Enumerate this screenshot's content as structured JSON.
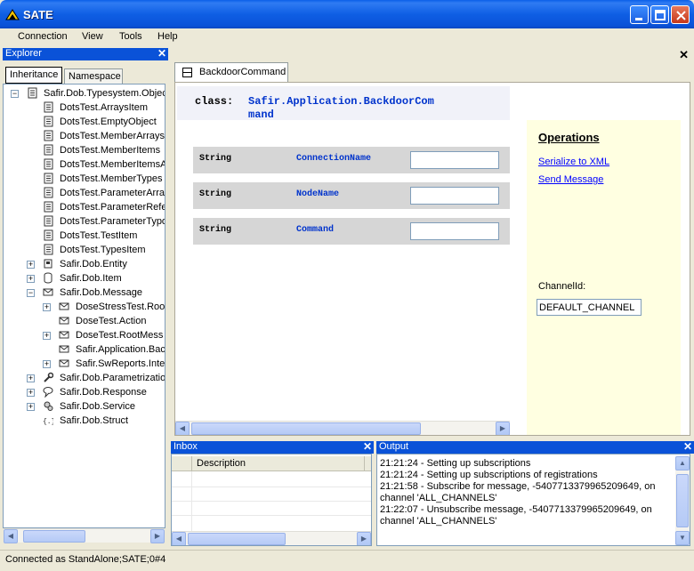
{
  "window": {
    "title": "SATE"
  },
  "menu": [
    "Connection",
    "View",
    "Tools",
    "Help"
  ],
  "explorer": {
    "title": "Explorer",
    "tabs": [
      "Inheritance",
      "Namespace"
    ],
    "tree": [
      {
        "label": "Safir.Dob.Typesystem.Objec",
        "level": 0,
        "expander": "-",
        "icon": "document-icon"
      },
      {
        "label": "DotsTest.ArraysItem",
        "level": 1,
        "expander": "",
        "icon": "document-icon"
      },
      {
        "label": "DotsTest.EmptyObject",
        "level": 1,
        "expander": "",
        "icon": "document-icon"
      },
      {
        "label": "DotsTest.MemberArrays",
        "level": 1,
        "expander": "",
        "icon": "document-icon"
      },
      {
        "label": "DotsTest.MemberItems",
        "level": 1,
        "expander": "",
        "icon": "document-icon"
      },
      {
        "label": "DotsTest.MemberItemsA",
        "level": 1,
        "expander": "",
        "icon": "document-icon"
      },
      {
        "label": "DotsTest.MemberTypes",
        "level": 1,
        "expander": "",
        "icon": "document-icon"
      },
      {
        "label": "DotsTest.ParameterArra",
        "level": 1,
        "expander": "",
        "icon": "document-icon"
      },
      {
        "label": "DotsTest.ParameterRefe",
        "level": 1,
        "expander": "",
        "icon": "document-icon"
      },
      {
        "label": "DotsTest.ParameterTypo",
        "level": 1,
        "expander": "",
        "icon": "document-icon"
      },
      {
        "label": "DotsTest.TestItem",
        "level": 1,
        "expander": "",
        "icon": "document-icon"
      },
      {
        "label": "DotsTest.TypesItem",
        "level": 1,
        "expander": "",
        "icon": "document-icon"
      },
      {
        "label": "Safir.Dob.Entity",
        "level": 1,
        "expander": "+",
        "icon": "entity-icon"
      },
      {
        "label": "Safir.Dob.Item",
        "level": 1,
        "expander": "+",
        "icon": "item-icon"
      },
      {
        "label": "Safir.Dob.Message",
        "level": 1,
        "expander": "-",
        "icon": "envelope-icon"
      },
      {
        "label": "DoseStressTest.Roo",
        "level": 2,
        "expander": "+",
        "icon": "envelope-icon"
      },
      {
        "label": "DoseTest.Action",
        "level": 2,
        "expander": "",
        "icon": "envelope-icon"
      },
      {
        "label": "DoseTest.RootMess",
        "level": 2,
        "expander": "+",
        "icon": "envelope-icon"
      },
      {
        "label": "Safir.Application.Bac",
        "level": 2,
        "expander": "",
        "icon": "envelope-icon"
      },
      {
        "label": "Safir.SwReports.Inte",
        "level": 2,
        "expander": "+",
        "icon": "envelope-icon"
      },
      {
        "label": "Safir.Dob.Parametrizatio",
        "level": 1,
        "expander": "+",
        "icon": "wrench-icon"
      },
      {
        "label": "Safir.Dob.Response",
        "level": 1,
        "expander": "+",
        "icon": "response-icon"
      },
      {
        "label": "Safir.Dob.Service",
        "level": 1,
        "expander": "+",
        "icon": "gears-icon"
      },
      {
        "label": "Safir.Dob.Struct",
        "level": 1,
        "expander": "",
        "icon": "struct-icon"
      }
    ]
  },
  "document": {
    "tab_label": "BackdoorCommand",
    "class_keyword": "class:",
    "class_name_line1": "Safir.Application.BackdoorCom",
    "class_name_line2": "mand",
    "fields": [
      {
        "type": "String",
        "name": "ConnectionName",
        "value": ""
      },
      {
        "type": "String",
        "name": "NodeName",
        "value": ""
      },
      {
        "type": "String",
        "name": "Command",
        "value": ""
      }
    ],
    "operations": {
      "title": "Operations",
      "serialize_link": "Serialize to XML",
      "send_link": "Send Message",
      "channel_label": "ChannelId:",
      "channel_value": "DEFAULT_CHANNEL"
    }
  },
  "inbox": {
    "title": "Inbox",
    "column": "Description"
  },
  "output": {
    "title": "Output",
    "lines": [
      "21:21:24 - Setting up subscriptions",
      "21:21:24 - Setting up subscriptions of registrations",
      "21:21:58 - Subscribe for message, -5407713379965209649, on",
      "channel 'ALL_CHANNELS'",
      "21:22:07 - Unsubscribe message, -5407713379965209649, on",
      "channel 'ALL_CHANNELS'"
    ]
  },
  "status": "Connected as StandAlone;SATE;0#4",
  "colors": {
    "title_blue": "#0a52d8",
    "type_blue": "#0033cc",
    "ops_bg": "#ffffe1"
  }
}
